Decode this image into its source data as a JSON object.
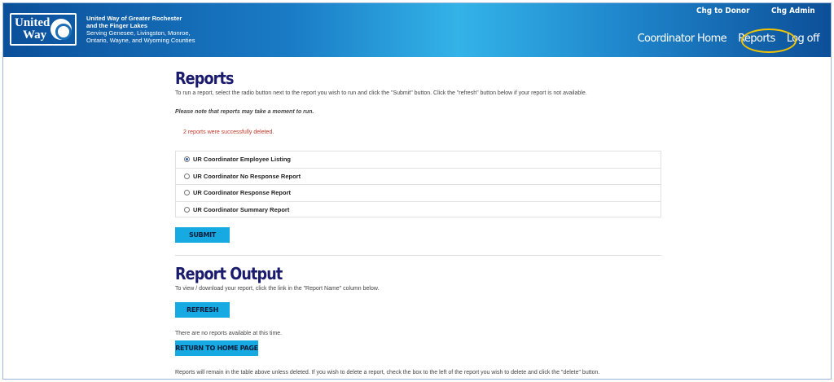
{
  "brand": {
    "logo_text_1": "United",
    "logo_text_2": "Way",
    "org_line1": "United Way of Greater Rochester",
    "org_line2": "and the Finger Lakes",
    "org_line3": "Serving Genesee, Livingston, Monroe,",
    "org_line4": "Ontario, Wayne, and Wyoming Counties"
  },
  "utility_nav": {
    "chg_donor": "Chg to Donor",
    "chg_admin": "Chg Admin"
  },
  "main_nav": {
    "home": "Coordinator Home",
    "reports": "Reports",
    "logoff": "Log off"
  },
  "reports": {
    "title": "Reports",
    "instructions": "To run a report, select the radio button next to the report you wish to run and click the \"Submit\" button. Click the \"refresh\" button below if your report is not available.",
    "note": "Please note that reports may take a moment to run.",
    "message": "2 reports were successfully deleted.",
    "options": [
      {
        "label": "UR Coordinator Employee Listing",
        "selected": true
      },
      {
        "label": "UR Coordinator No Response Report",
        "selected": false
      },
      {
        "label": "UR Coordinator Response Report",
        "selected": false
      },
      {
        "label": "UR Coordinator Summary Report",
        "selected": false
      }
    ],
    "submit_label": "SUBMIT"
  },
  "output": {
    "title": "Report Output",
    "instructions": "To view / download your report, click the link in the \"Report Name\" column below.",
    "refresh_label": "REFRESH",
    "empty_message": "There are no reports available at this time.",
    "home_label": "RETURN TO HOME PAGE",
    "footer": "Reports will remain in the table above unless deleted. If you wish to delete a report, check the box to the left of the report you wish to delete and click the \"delete\" button."
  },
  "colors": {
    "header_dark": "#0b4f9a",
    "header_light": "#33b3e8",
    "button": "#17a9e1",
    "heading": "#1b1b6e",
    "highlight": "#f5c400",
    "message": "#c0392b"
  }
}
